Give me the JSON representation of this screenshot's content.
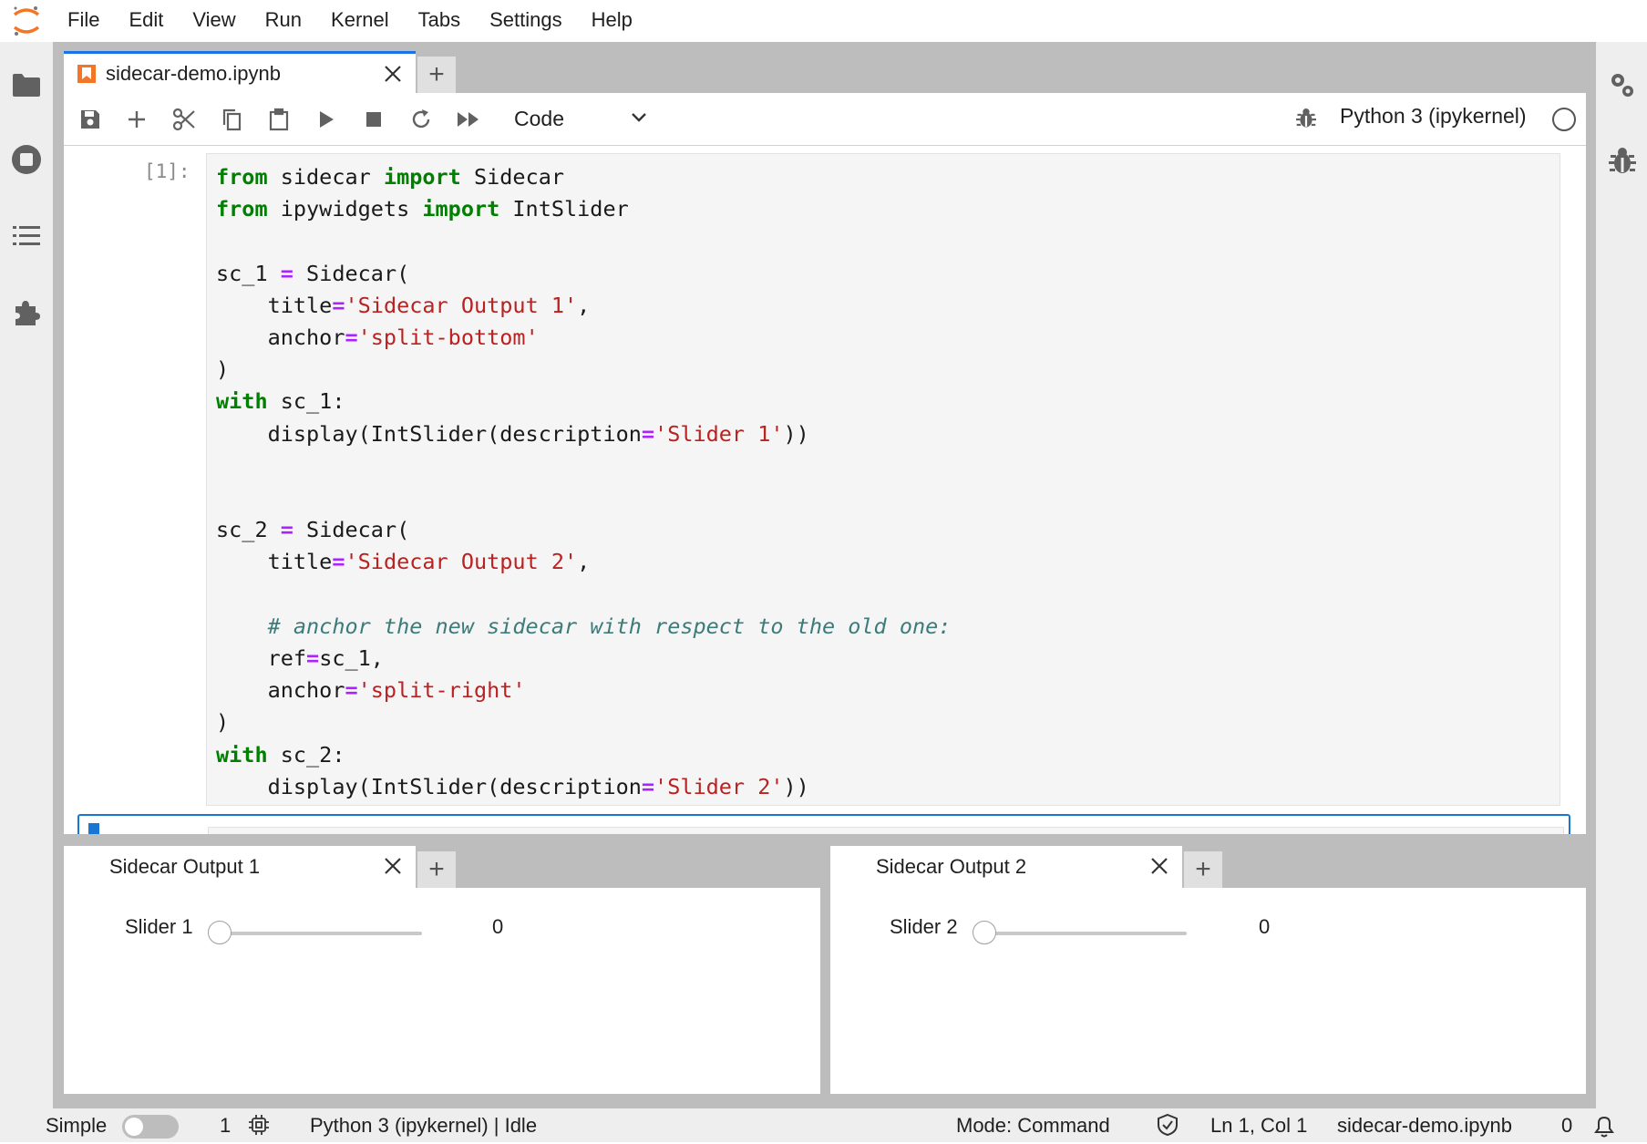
{
  "menubar": {
    "items": [
      "File",
      "Edit",
      "View",
      "Run",
      "Kernel",
      "Tabs",
      "Settings",
      "Help"
    ]
  },
  "left_sidebar": {
    "icons": [
      "folder-icon",
      "running-icon",
      "table-of-contents-icon",
      "extension-icon"
    ]
  },
  "right_sidebar": {
    "icons": [
      "property-inspector-icon",
      "debugger-icon"
    ]
  },
  "notebook": {
    "tab": {
      "label": "sidecar-demo.ipynb"
    },
    "toolbar": {
      "buttons": [
        "save-icon",
        "insert-cell-icon",
        "cut-icon",
        "copy-icon",
        "paste-icon",
        "run-icon",
        "stop-icon",
        "restart-icon",
        "run-all-icon"
      ],
      "cell_type": "Code",
      "kernel_name": "Python 3 (ipykernel)"
    },
    "cell": {
      "prompt": "[1]:"
    }
  },
  "sidecars": [
    {
      "title": "Sidecar Output 1",
      "slider_label": "Slider 1",
      "slider_value": "0",
      "slider_fraction": 0
    },
    {
      "title": "Sidecar Output 2",
      "slider_label": "Slider 2",
      "slider_value": "0",
      "slider_fraction": 0
    }
  ],
  "statusbar": {
    "simple_label": "Simple",
    "simple_enabled": false,
    "terminal_count": "1",
    "kernel_status": "Python 3 (ipykernel) | Idle",
    "mode": "Mode: Command",
    "cursor": "Ln 1, Col 1",
    "file": "sidecar-demo.ipynb",
    "notifications": "0"
  },
  "colors": {
    "accent": "#1976d2",
    "keyword": "#008000",
    "string": "#ba2121",
    "operator": "#aa22ff",
    "comment": "#3d7b7b",
    "logo": "#f37626"
  }
}
